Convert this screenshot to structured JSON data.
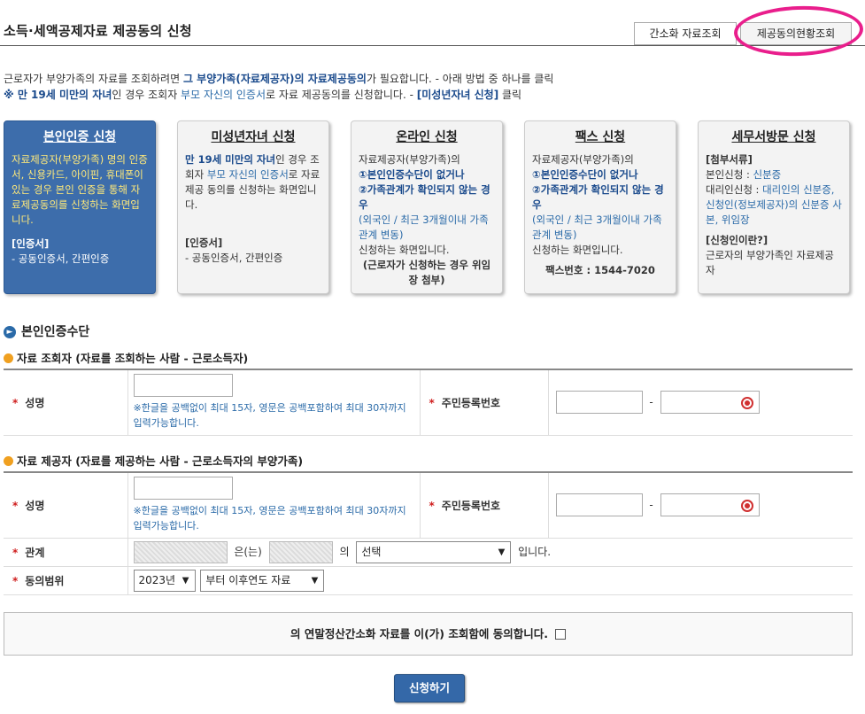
{
  "page": {
    "title": "소득·세액공제자료 제공동의 신청"
  },
  "top_buttons": {
    "simple": "간소화 자료조회",
    "status": "제공동의현황조회"
  },
  "intro": {
    "line1_a": "근로자가 부양가족의 자료를 조회하려면 ",
    "line1_b": "그 부양가족(자료제공자)의 자료제공동의",
    "line1_c": "가 필요합니다. - 아래 방법 중 하나를 클릭",
    "line2_a": "※ 만 19세 미만의 자녀",
    "line2_b": "인 경우 조회자 ",
    "line2_c": "부모 자신의 인증서",
    "line2_d": "로 자료 제공동의를 신청합니다. - ",
    "line2_e": "[미성년자녀 신청]",
    "line2_f": " 클릭"
  },
  "cards": {
    "self": {
      "title": "본인인증 신청",
      "desc": "자료제공자(부양가족) 명의 인증서, 신용카드, 아이핀, 휴대폰이 있는 경우 본인 인증을 통해 자료제공동의를 신청하는 화면입니다.",
      "cert_label": "[인증서]",
      "cert_value": "- 공동인증서, 간편인증"
    },
    "minor": {
      "title": "미성년자녀 신청",
      "desc_a": "만 19세 미만의 자녀",
      "desc_b": "인 경우 조회자 ",
      "desc_c": "부모 자신의 인증서",
      "desc_d": "로 자료 제공 동의를 신청하는 화면입니다.",
      "cert_label": "[인증서]",
      "cert_value": "- 공동인증서, 간편인증"
    },
    "online": {
      "title": "온라인 신청",
      "l1": "자료제공자(부양가족)의",
      "l2": "①본인인증수단이 없거나",
      "l3": "②가족관계가 확인되지 않는 경우",
      "l4": "(외국인 / 최근 3개월이내 가족관계 변동)",
      "l5": "신청하는 화면입니다.",
      "l6": "(근로자가 신청하는 경우 위임장 첨부)"
    },
    "fax": {
      "title": "팩스 신청",
      "l1": "자료제공자(부양가족)의",
      "l2": "①본인인증수단이 없거나",
      "l3": "②가족관계가 확인되지 않는 경우",
      "l4": "(외국인 / 최근 3개월이내 가족관계 변동)",
      "l5": "신청하는 화면입니다.",
      "fax_no": "팩스번호 : 1544-7020"
    },
    "visit": {
      "title": "세무서방문 신청",
      "docs_label": "[첨부서류]",
      "self_a": "본인신청 : ",
      "self_b": "신분증",
      "proxy_a": "대리인신청 : ",
      "proxy_b": "대리인의 신분증, 신청인(정보제공자)의 신분증 사본, 위임장",
      "who_label": "[신청인이란?]",
      "who_value": "근로자의 부양가족인 자료제공자"
    }
  },
  "section": {
    "title": "본인인증수단"
  },
  "viewer": {
    "title": "자료 조회자 (자료를 조회하는 사람 - 근로소득자)",
    "name_label": "성명",
    "name_value": "",
    "hint_a": "※",
    "hint_b": "한글을 공백없이 최대 15자, 영문은 공백포함하여 최대 30자까지 입력가능합니다.",
    "rrn_label": "주민등록번호",
    "rrn_sep": "-"
  },
  "provider": {
    "title": "자료 제공자 (자료를 제공하는 사람 - 근로소득자의 부양가족)",
    "name_label": "성명",
    "hint_a": "※",
    "hint_b": "한글을 공백없이 최대 15자, 영문은 공백포함하여 최대 30자까지 입력가능합니다.",
    "rrn_label": "주민등록번호",
    "rrn_sep": "-",
    "relation_label": "관계",
    "relation_p1": "은(는)",
    "relation_p2": "의",
    "relation_select": "선택",
    "relation_end": "입니다.",
    "scope_label": "동의범위",
    "scope_year": "2023년",
    "scope_range": "부터 이후연도 자료"
  },
  "agree": {
    "text": "의 연말정산간소화 자료를 이(가) 조회함에 동의합니다."
  },
  "submit": {
    "label": "신청하기"
  },
  "colors": {
    "accent": "#3d6dab",
    "highlight": "#e91e8c",
    "required": "#d02020"
  }
}
